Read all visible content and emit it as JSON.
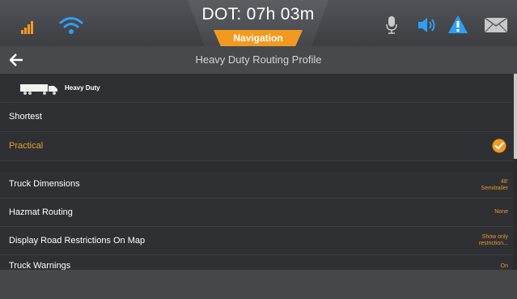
{
  "status_bar": {
    "dot_label": "DOT: 07h 03m",
    "mode_tab": "Navigation",
    "icons": [
      "signal-bars-icon",
      "wifi-icon",
      "microphone-icon",
      "speaker-icon",
      "warning-icon",
      "mail-icon"
    ]
  },
  "header": {
    "back_icon": "arrow-left-icon",
    "title": "Heavy Duty Routing Profile"
  },
  "profile": {
    "vehicle_icon": "truck-icon",
    "label": "Heavy Duty"
  },
  "route_options": [
    {
      "label": "Shortest",
      "selected": false
    },
    {
      "label": "Practical",
      "selected": true
    }
  ],
  "settings": [
    {
      "label": "Truck Dimensions",
      "value_line1": "48'",
      "value_line2": "Semitrailer"
    },
    {
      "label": "Hazmat Routing",
      "value_line1": "None",
      "value_line2": ""
    },
    {
      "label": "Display Road Restrictions On Map",
      "value_line1": "Show only",
      "value_line2": "restriction..."
    },
    {
      "label": "Truck Warnings",
      "value_line1": "On",
      "value_line2": ""
    }
  ],
  "colors": {
    "accent": "#f29a1f",
    "selected_text": "#e8a12b",
    "background": "#2b2c30",
    "header": "#47494d"
  }
}
